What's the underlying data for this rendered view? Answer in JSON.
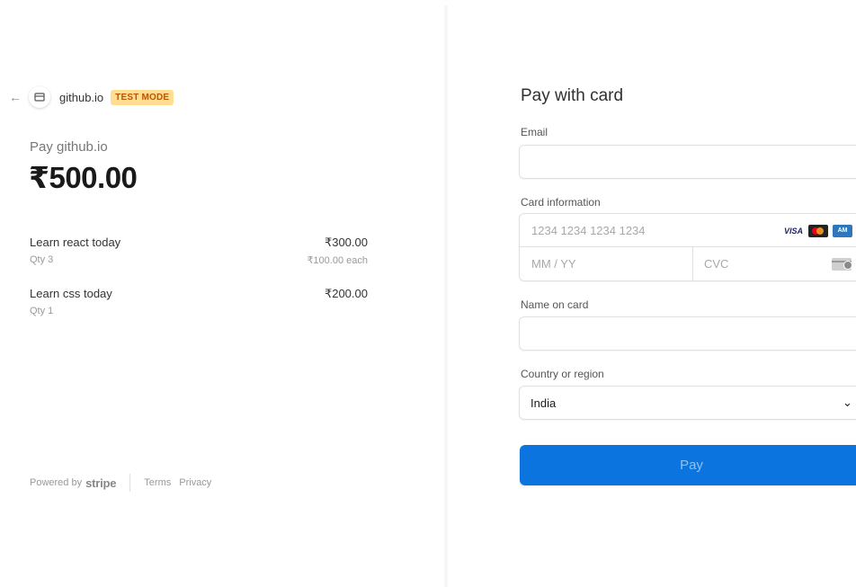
{
  "header": {
    "merchant": "github.io",
    "badge": "TEST MODE"
  },
  "summary": {
    "pay_label": "Pay github.io",
    "amount": "₹500.00",
    "items": [
      {
        "name": "Learn react today",
        "price": "₹300.00",
        "qty": "Qty 3",
        "each": "₹100.00 each"
      },
      {
        "name": "Learn css today",
        "price": "₹200.00",
        "qty": "Qty 1",
        "each": ""
      }
    ]
  },
  "footer": {
    "powered_by": "Powered by",
    "brand": "stripe",
    "terms": "Terms",
    "privacy": "Privacy"
  },
  "form": {
    "title": "Pay with card",
    "email_label": "Email",
    "email_value": "",
    "card_label": "Card information",
    "card_number_placeholder": "1234 1234 1234 1234",
    "expiry_placeholder": "MM / YY",
    "cvc_placeholder": "CVC",
    "card_brands": [
      "visa-icon",
      "mastercard-icon",
      "amex-icon"
    ],
    "name_label": "Name on card",
    "name_value": "",
    "country_label": "Country or region",
    "country_value": "India",
    "pay_button": "Pay"
  },
  "colors": {
    "accent": "#0b74de",
    "badge_bg": "#ffde92",
    "badge_text": "#bb5504"
  }
}
